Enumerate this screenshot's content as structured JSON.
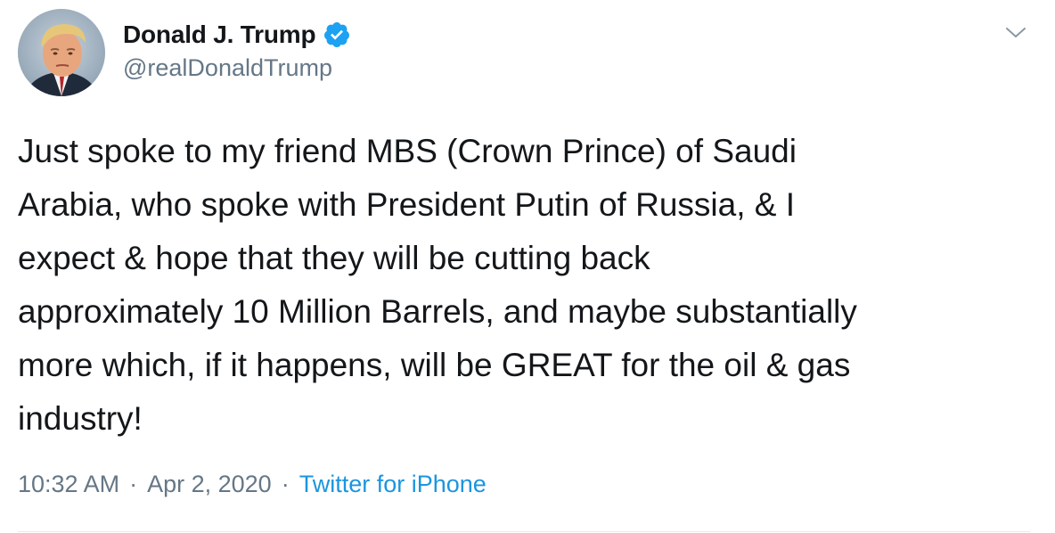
{
  "author": {
    "display_name": "Donald J. Trump",
    "handle": "@realDonaldTrump",
    "verified": true,
    "verified_icon": "verified-badge-icon"
  },
  "menu": {
    "icon": "chevron-down-icon"
  },
  "tweet": {
    "text": "Just spoke to my friend MBS (Crown Prince) of Saudi\nArabia, who spoke with President Putin of Russia, & I\nexpect & hope that they will be cutting back\napproximately 10 Million Barrels, and maybe substantially\nmore which, if it happens, will be GREAT for the oil & gas\nindustry!",
    "time": "10:32 AM",
    "separator": "·",
    "date": "Apr 2, 2020",
    "source": "Twitter for iPhone"
  },
  "colors": {
    "text_primary": "#14171a",
    "text_secondary": "#657786",
    "link": "#1b95e0",
    "verified_blue": "#1da1f2",
    "divider": "#e6ecf0"
  }
}
